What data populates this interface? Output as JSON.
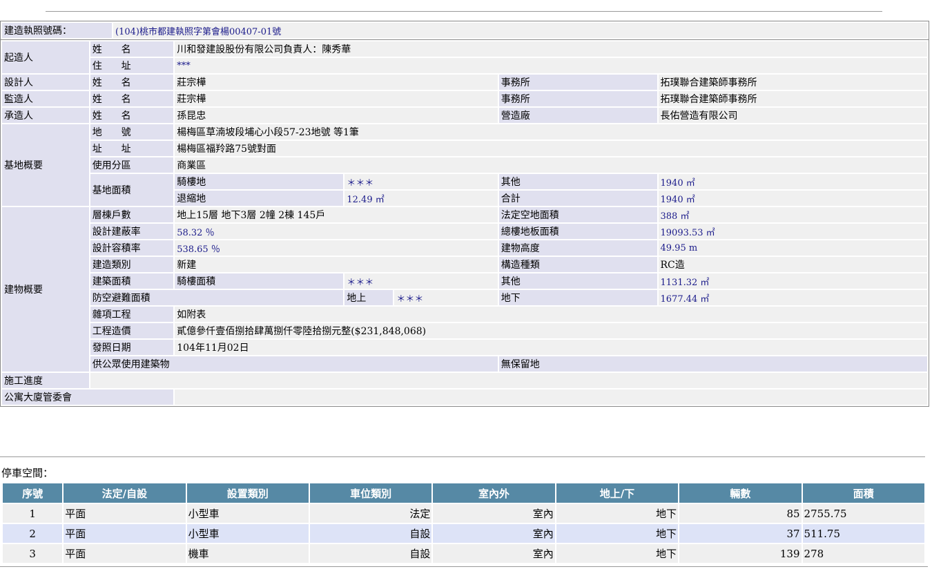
{
  "permit": {
    "label": "建造執照號碼：",
    "value": "(104)桃市都建執照字第會楊00407-01號"
  },
  "owner": {
    "section": "起造人",
    "name_label": "姓　　名",
    "name": "川和發建設股份有限公司負責人：陳秀華",
    "addr_label": "住　　址",
    "addr": "***"
  },
  "designer": {
    "section": "設計人",
    "name_label": "姓　　名",
    "name": "莊宗樺",
    "office_label": "事務所",
    "office": "拓璞聯合建築師事務所"
  },
  "supervisor": {
    "section": "監造人",
    "name_label": "姓　　名",
    "name": "莊宗樺",
    "office_label": "事務所",
    "office": "拓璞聯合建築師事務所"
  },
  "contractor": {
    "section": "承造人",
    "name_label": "姓　　名",
    "name": "孫昆忠",
    "office_label": "營造廠",
    "office": "長佑營造有限公司"
  },
  "site": {
    "section": "基地概要",
    "lot_label": "地　　號",
    "lot": "楊梅區草湳坡段埔心小段57-23地號 等1筆",
    "addr_label": "址　　址",
    "addr": "楊梅區福羚路75號對面",
    "zone_label": "使用分區",
    "zone": "商業區",
    "area_label": "基地面積",
    "arcade_label": "騎樓地",
    "arcade": "＊＊＊",
    "other_label": "其他",
    "other": "1940 ㎡",
    "setback_label": "退縮地",
    "setback": "12.49 ㎡",
    "total_label": "合計",
    "total": "1940 ㎡"
  },
  "building": {
    "section": "建物概要",
    "units_label": "層棟戶數",
    "units": "地上15層 地下3層 2幢 2棟 145戶",
    "open_label": "法定空地面積",
    "open": "388 ㎡",
    "coverage_label": "設計建蔽率",
    "coverage": "58.32 ％",
    "floor_label": "總樓地板面積",
    "floor": "19093.53 ㎡",
    "far_label": "設計容積率",
    "far": "538.65 ％",
    "height_label": "建物高度",
    "height": "49.95 m",
    "type_label": "建造類別",
    "type": "新建",
    "struct_label": "構造種類",
    "struct": "RC造",
    "bldg_area_label": "建築面積",
    "arcade_area_label": "騎樓面積",
    "arcade_area": "＊＊＊",
    "other_label": "其他",
    "other": "1131.32 ㎡",
    "shelter_label": "防空避難面積",
    "above_label": "地上",
    "above": "＊＊＊",
    "below_label": "地下",
    "below": "1677.44 ㎡",
    "misc_label": "雜項工程",
    "misc": "如附表",
    "cost_label": "工程造價",
    "cost": "貳億參仟壹佰捌拾肆萬捌仟零陸拾捌元整($231,848,068)",
    "date_label": "發照日期",
    "date": "104年11月02日",
    "public_label": "供公眾使用建築物",
    "reserve_label": "無保留地"
  },
  "progress_label": "施工進度",
  "committee_label": "公寓大廈管委會",
  "parking": {
    "title": "停車空間：",
    "headers": [
      "序號",
      "法定/自設",
      "設置類別",
      "車位類別",
      "室內外",
      "地上/下",
      "輛數",
      "面積"
    ],
    "rows": [
      [
        "1",
        "平面",
        "小型車",
        "法定",
        "室內",
        "地下",
        "85",
        "2755.75"
      ],
      [
        "2",
        "平面",
        "小型車",
        "自設",
        "室內",
        "地下",
        "37",
        "511.75"
      ],
      [
        "3",
        "平面",
        "機車",
        "自設",
        "室內",
        "地下",
        "139",
        "278"
      ]
    ]
  }
}
